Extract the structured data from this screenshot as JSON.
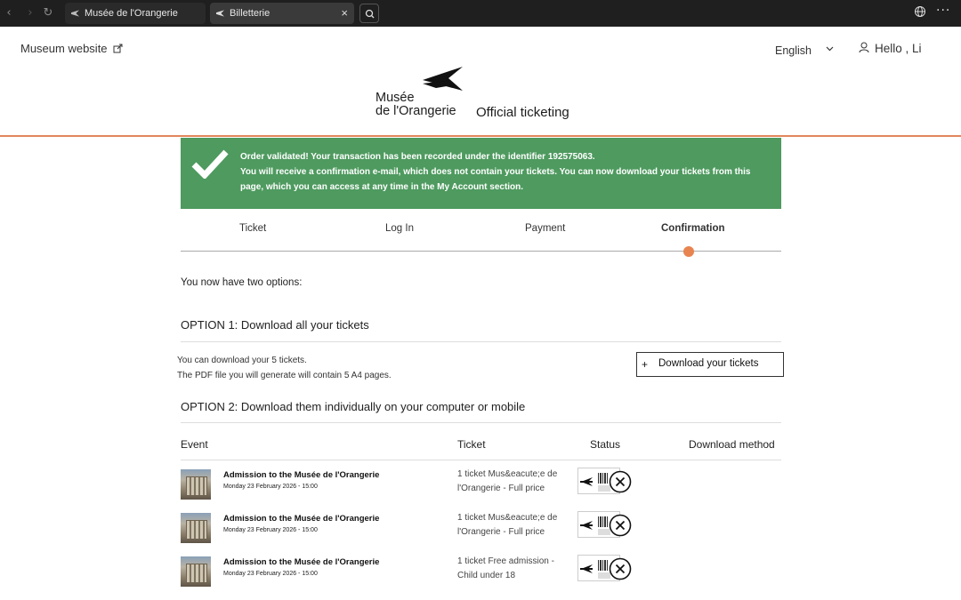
{
  "browser": {
    "tabs": [
      {
        "label": "Musée de l'Orangerie"
      },
      {
        "label": "Billetterie"
      }
    ],
    "icons": {
      "back": "back-arrow-icon",
      "forward": "forward-arrow-icon",
      "reload": "reload-icon",
      "search": "search-icon",
      "globe": "globe-icon",
      "more": "more-icon"
    }
  },
  "header": {
    "museum_link": "Museum website",
    "language": "English",
    "user_greeting": "Hello , Li",
    "logo_line1": "Musée",
    "logo_line2": "de l'Orangerie",
    "subtitle": "Official ticketing",
    "accent": "#e2875b"
  },
  "banner": {
    "line1": "Order validated! Your transaction has been recorded under the identifier 192575063.",
    "line2": "You will receive a confirmation e-mail, which does not contain your tickets. You can now download your tickets from this page, which you can access at any time in the My Account section.",
    "color": "#4e9a5f"
  },
  "steps": {
    "items": [
      "Ticket",
      "Log In",
      "Payment",
      "Confirmation"
    ],
    "active": "Confirmation",
    "dot_color": "#e8844f"
  },
  "main": {
    "intro": "You now have two options:",
    "option1": {
      "title": "OPTION 1: Download all your tickets",
      "line1": "You can download your 5 tickets.",
      "line2": "The PDF file you will generate will contain 5 A4 pages.",
      "button": "Download your tickets"
    },
    "option2": {
      "title": "OPTION 2: Download them individually on your computer or mobile"
    }
  },
  "table": {
    "headers": [
      "Event",
      "Ticket",
      "Status",
      "Download method"
    ],
    "rows": [
      {
        "event": "Admission to the Musée de l'Orangerie",
        "date": "Monday 23 February 2026 - 15:00",
        "ticket": "1 ticket Mus&eacute;e de l'Orangerie - Full price"
      },
      {
        "event": "Admission to the Musée de l'Orangerie",
        "date": "Monday 23 February 2026 - 15:00",
        "ticket": "1 ticket Mus&eacute;e de l'Orangerie - Full price"
      },
      {
        "event": "Admission to the Musée de l'Orangerie",
        "date": "Monday 23 February 2026 - 15:00",
        "ticket": "1 ticket Free admission - Child under 18"
      }
    ]
  }
}
